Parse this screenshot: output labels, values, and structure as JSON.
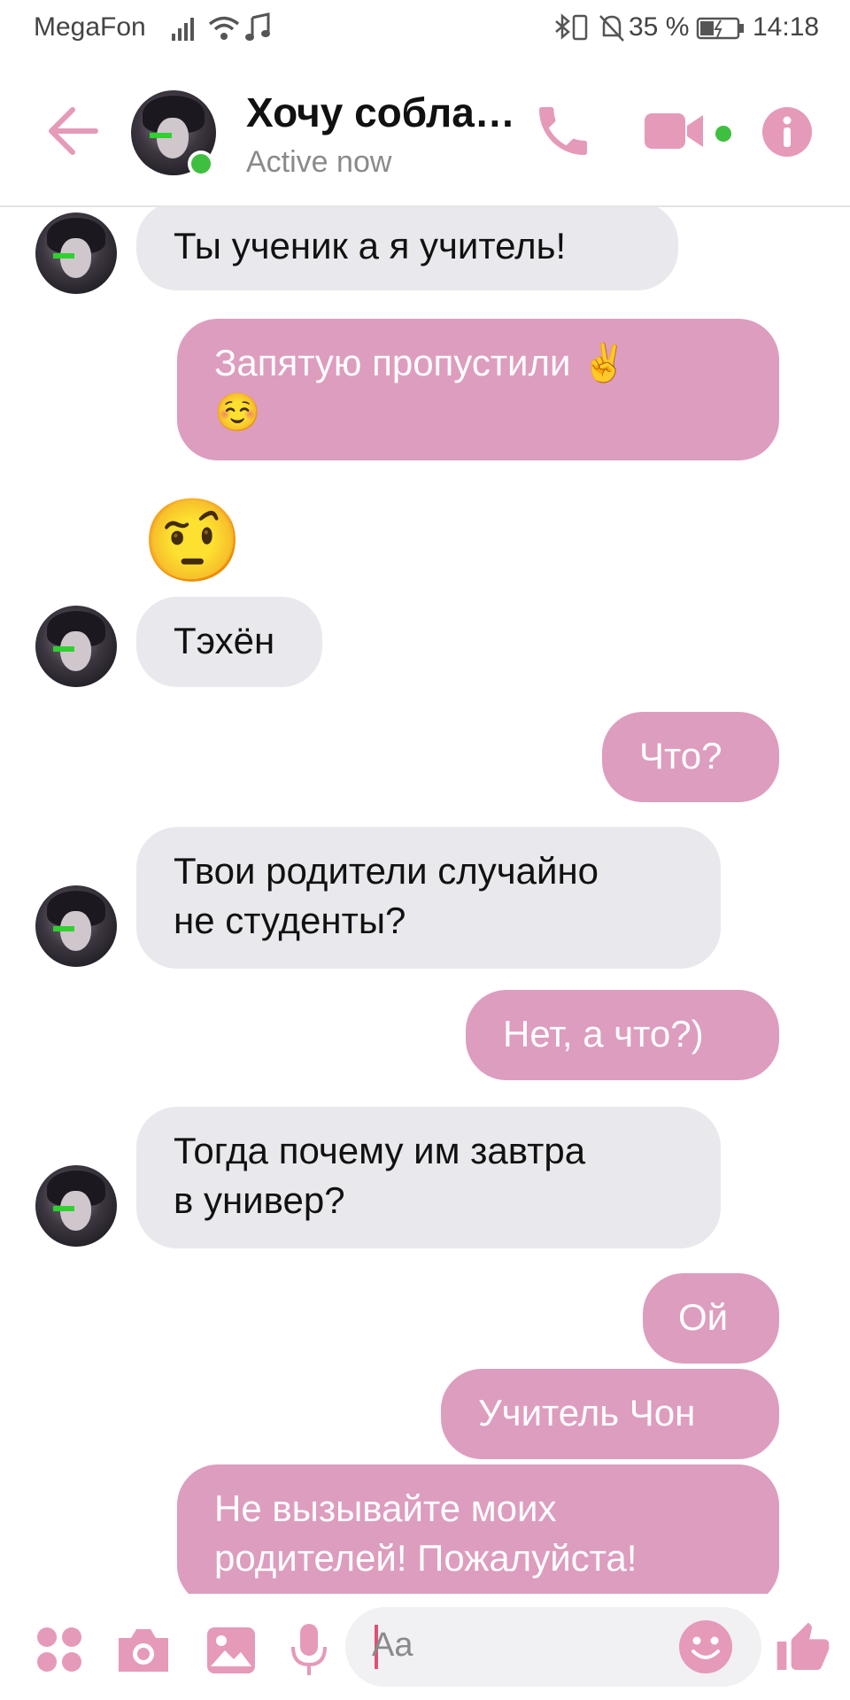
{
  "status_bar": {
    "carrier": "MegaFon",
    "battery": "35 %",
    "time": "14:18"
  },
  "header": {
    "contact_name": "Хочу собла…",
    "status": "Active now"
  },
  "messages": [
    {
      "side": "in",
      "text": "Ты ученик а я учитель!"
    },
    {
      "side": "out",
      "text": "Запятую пропустили ✌️\n☺️"
    },
    {
      "side": "in",
      "text": "🤨"
    },
    {
      "side": "in",
      "text": "Тэхён"
    },
    {
      "side": "out",
      "text": "Что?"
    },
    {
      "side": "in",
      "text": "Твои родители случайно\nне студенты?"
    },
    {
      "side": "out",
      "text": "Нет, а что?)"
    },
    {
      "side": "in",
      "text": "Тогда почему им завтра\nв универ?"
    },
    {
      "side": "out",
      "text": "Ой"
    },
    {
      "side": "out",
      "text": "Учитель Чон"
    },
    {
      "side": "out",
      "text": "Не вызывайте моих\nродителей! Пожалуйста!"
    }
  ],
  "composer": {
    "placeholder": "Aa"
  },
  "colors": {
    "accent": "#e59aba",
    "outgoing_bubble": "#dd9dbf",
    "incoming_bubble": "#e9e8ec",
    "online_dot": "#3fbf3f"
  }
}
